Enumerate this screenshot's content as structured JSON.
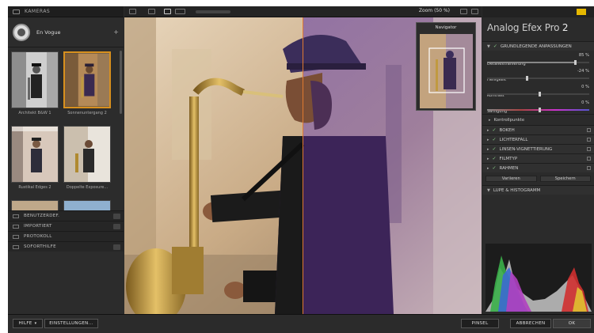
{
  "left_panel": {
    "header": "KAMERAS",
    "collection": "En Vogue",
    "add": "+",
    "presets": [
      {
        "label": "Architekt B&W 1"
      },
      {
        "label": "Sonnenuntergang 2"
      },
      {
        "label": "Rustikal Edges 2"
      },
      {
        "label": "Doppelte Exposure..."
      }
    ],
    "sections": [
      "BENUTZERDEF.",
      "IMPORTIERT",
      "PROTOKOLL",
      "SOFORTHILFE"
    ]
  },
  "canvas": {
    "zoom": "Zoom (50 %)",
    "navigator_title": "Navigator"
  },
  "right_panel": {
    "title": "Analog Efex Pro",
    "version": "2",
    "basic_section": "GRUNDLEGENDE ANPASSUNGEN",
    "sliders": [
      {
        "label": "Detailextrahierung",
        "value": "85 %",
        "level": 0.85
      },
      {
        "label": "Helligkeit",
        "value": "-24 %",
        "level": 0.38
      },
      {
        "label": "Kontrast",
        "value": "0 %",
        "level": 0.5
      },
      {
        "label": "Sättigung",
        "value": "0 %",
        "level": 0.5
      }
    ],
    "control_points": "Kontrollpunkte",
    "effects": [
      "BOKEH",
      "LICHTERFALL",
      "LINSEN-VIGNETTIERUNG",
      "FILMTYP",
      "RAHMEN"
    ],
    "vary_button": "Variieren",
    "save_button": "Speichern",
    "histogram_section": "LUPE & HISTOGRAMM"
  },
  "bottom_bar": {
    "help": "HILFE",
    "settings": "EINSTELLUNGEN...",
    "brush": "PINSEL",
    "cancel": "ABBRECHEN",
    "ok": "OK"
  }
}
